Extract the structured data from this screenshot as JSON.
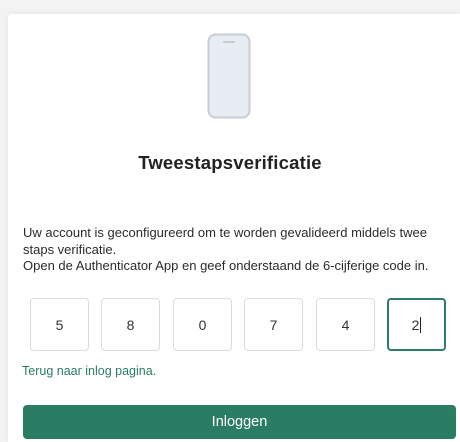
{
  "icon": "smartphone-icon",
  "title": "Tweestapsverificatie",
  "description": {
    "line1": "Uw account is geconfigureerd om te worden gevalideerd middels twee staps verificatie.",
    "line2": "Open de Authenticator App en geef onderstaand de 6-cijferige code in."
  },
  "code_digits": [
    "5",
    "8",
    "0",
    "7",
    "4",
    "2"
  ],
  "active_digit_index": 5,
  "back_link": "Terug naar inlog pagina.",
  "login_button": "Inloggen",
  "colors": {
    "accent": "#2a7d62",
    "phone_fill": "#e8ecf3",
    "phone_stroke": "#c7ccd6"
  }
}
